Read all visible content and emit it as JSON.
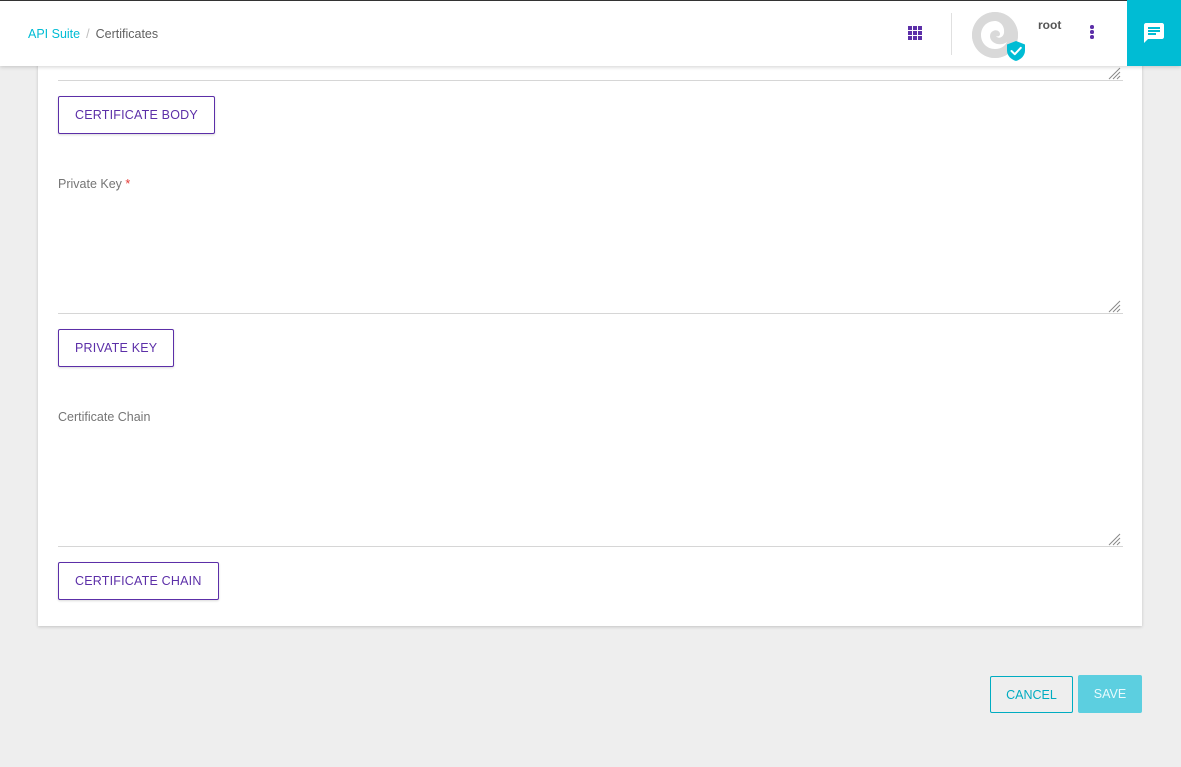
{
  "header": {
    "breadcrumb": {
      "root": "API Suite",
      "separator": "/",
      "current": "Certificates"
    },
    "apps_icon": "apps-grid-icon",
    "username": "root",
    "menu_icon": "more-vertical-icon",
    "chat_icon": "chat-message-icon"
  },
  "form": {
    "certificate_body": {
      "value": "",
      "button_label": "CERTIFICATE BODY"
    },
    "private_key": {
      "label": "Private Key",
      "required_marker": "*",
      "value": "",
      "button_label": "PRIVATE KEY"
    },
    "certificate_chain": {
      "label": "Certificate Chain",
      "value": "",
      "button_label": "CERTIFICATE CHAIN"
    }
  },
  "actions": {
    "cancel_label": "CANCEL",
    "save_label": "SAVE"
  },
  "colors": {
    "accent_teal": "#00bcd4",
    "accent_purple": "#5c2fa8",
    "required_red": "#e53935",
    "background": "#eeeeee"
  }
}
